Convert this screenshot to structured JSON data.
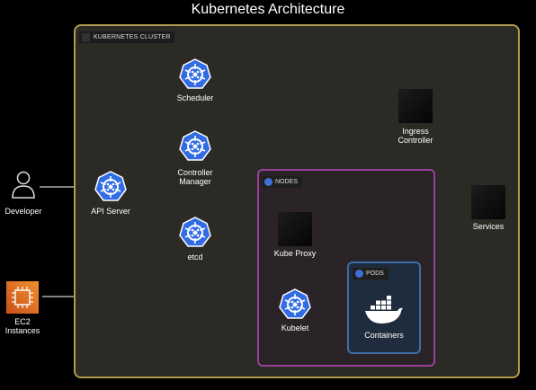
{
  "title": "Kubernetes Architecture",
  "cluster": {
    "label": "KUBERNETES CLUSTER"
  },
  "nodes_group": {
    "label": "NODES"
  },
  "pods_group": {
    "label": "PODS"
  },
  "components": {
    "developer": "Developer",
    "ec2": "EC2\nInstances",
    "api_server": "API Server",
    "scheduler": "Scheduler",
    "controller_manager": "Controller\nManager",
    "etcd": "etcd",
    "kube_proxy": "Kube Proxy",
    "kubelet": "Kubelet",
    "containers": "Containers",
    "ingress_controller": "Ingress\nController",
    "services": "Services"
  },
  "colors": {
    "cluster_border": "#b29a4e",
    "nodes_border": "#9b3f9c",
    "pods_border": "#3a6ea8",
    "k8s_blue": "#326ce5",
    "ec2_orange": "#e8752a",
    "docker_blue": "#1d91e6"
  },
  "icons": {
    "developer": "person-icon",
    "ec2": "aws-ec2-icon",
    "k8s": "kubernetes-wheel-icon",
    "containers": "docker-whale-icon",
    "generic": "dark-square-icon"
  }
}
